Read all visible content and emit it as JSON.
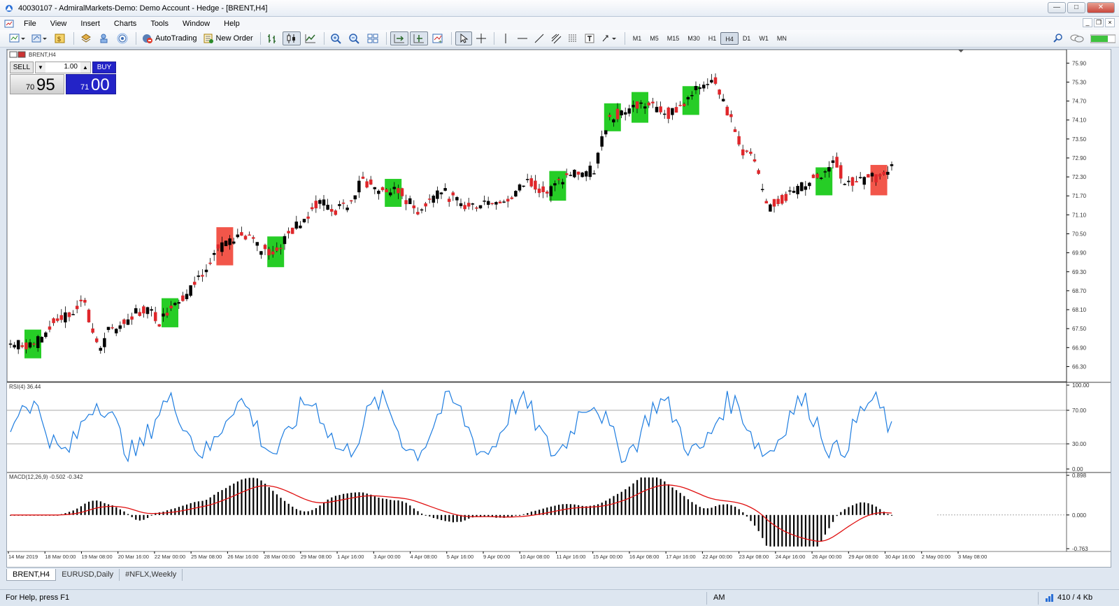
{
  "window": {
    "title": "40030107 - AdmiralMarkets-Demo: Demo Account - Hedge - [BRENT,H4]"
  },
  "menu": [
    "File",
    "View",
    "Insert",
    "Charts",
    "Tools",
    "Window",
    "Help"
  ],
  "toolbar": {
    "autotrading_label": "AutoTrading",
    "new_order_label": "New Order",
    "timeframes": [
      "M1",
      "M5",
      "M15",
      "M30",
      "H1",
      "H4",
      "D1",
      "W1",
      "MN"
    ],
    "active_timeframe": "H4"
  },
  "chart": {
    "label": "BRENT,H4",
    "trade_panel": {
      "sell_label": "SELL",
      "buy_label": "BUY",
      "lot": "1.00",
      "sell_small": "70",
      "sell_big": "95",
      "buy_small": "71",
      "buy_big": "00"
    },
    "price_ticks": [
      "75.90",
      "75.30",
      "74.70",
      "74.10",
      "73.50",
      "72.90",
      "72.30",
      "71.70",
      "71.10",
      "70.50",
      "69.90",
      "69.30",
      "68.70",
      "68.10",
      "67.50",
      "66.90",
      "66.30"
    ],
    "rsi_label": "RSI(4) 36.44",
    "rsi_ticks": [
      "100.00",
      "70.00",
      "30.00",
      "0.00"
    ],
    "macd_label": "MACD(12,26,9) -0.502 -0.342",
    "macd_ticks": [
      "0.898",
      "0.000",
      "-0.763"
    ],
    "time_labels": [
      "14 Mar 2019",
      "18 Mar 00:00",
      "19 Mar 08:00",
      "20 Mar 16:00",
      "22 Mar 00:00",
      "25 Mar 08:00",
      "26 Mar 16:00",
      "28 Mar 00:00",
      "29 Mar 08:00",
      "1 Apr 16:00",
      "3 Apr 00:00",
      "4 Apr 08:00",
      "5 Apr 16:00",
      "9 Apr 00:00",
      "10 Apr 08:00",
      "11 Apr 16:00",
      "15 Apr 00:00",
      "16 Apr 08:00",
      "17 Apr 16:00",
      "22 Apr 00:00",
      "23 Apr 08:00",
      "24 Apr 16:00",
      "26 Apr 00:00",
      "29 Apr 08:00",
      "30 Apr 16:00",
      "2 May 00:00",
      "3 May 08:00"
    ]
  },
  "tabs": [
    "BRENT,H4",
    "EURUSD,Daily",
    "#NFLX,Weekly"
  ],
  "status": {
    "help": "For Help, press F1",
    "profile": "AM",
    "traffic": "410 / 4 Kb"
  },
  "colors": {
    "bull": "#000000",
    "bear": "#e0262a",
    "green_box": "#00c400",
    "red_box": "#f0382a",
    "rsi": "#1e7de0",
    "macd_signal": "#e01010",
    "buy": "#2323c7"
  }
}
